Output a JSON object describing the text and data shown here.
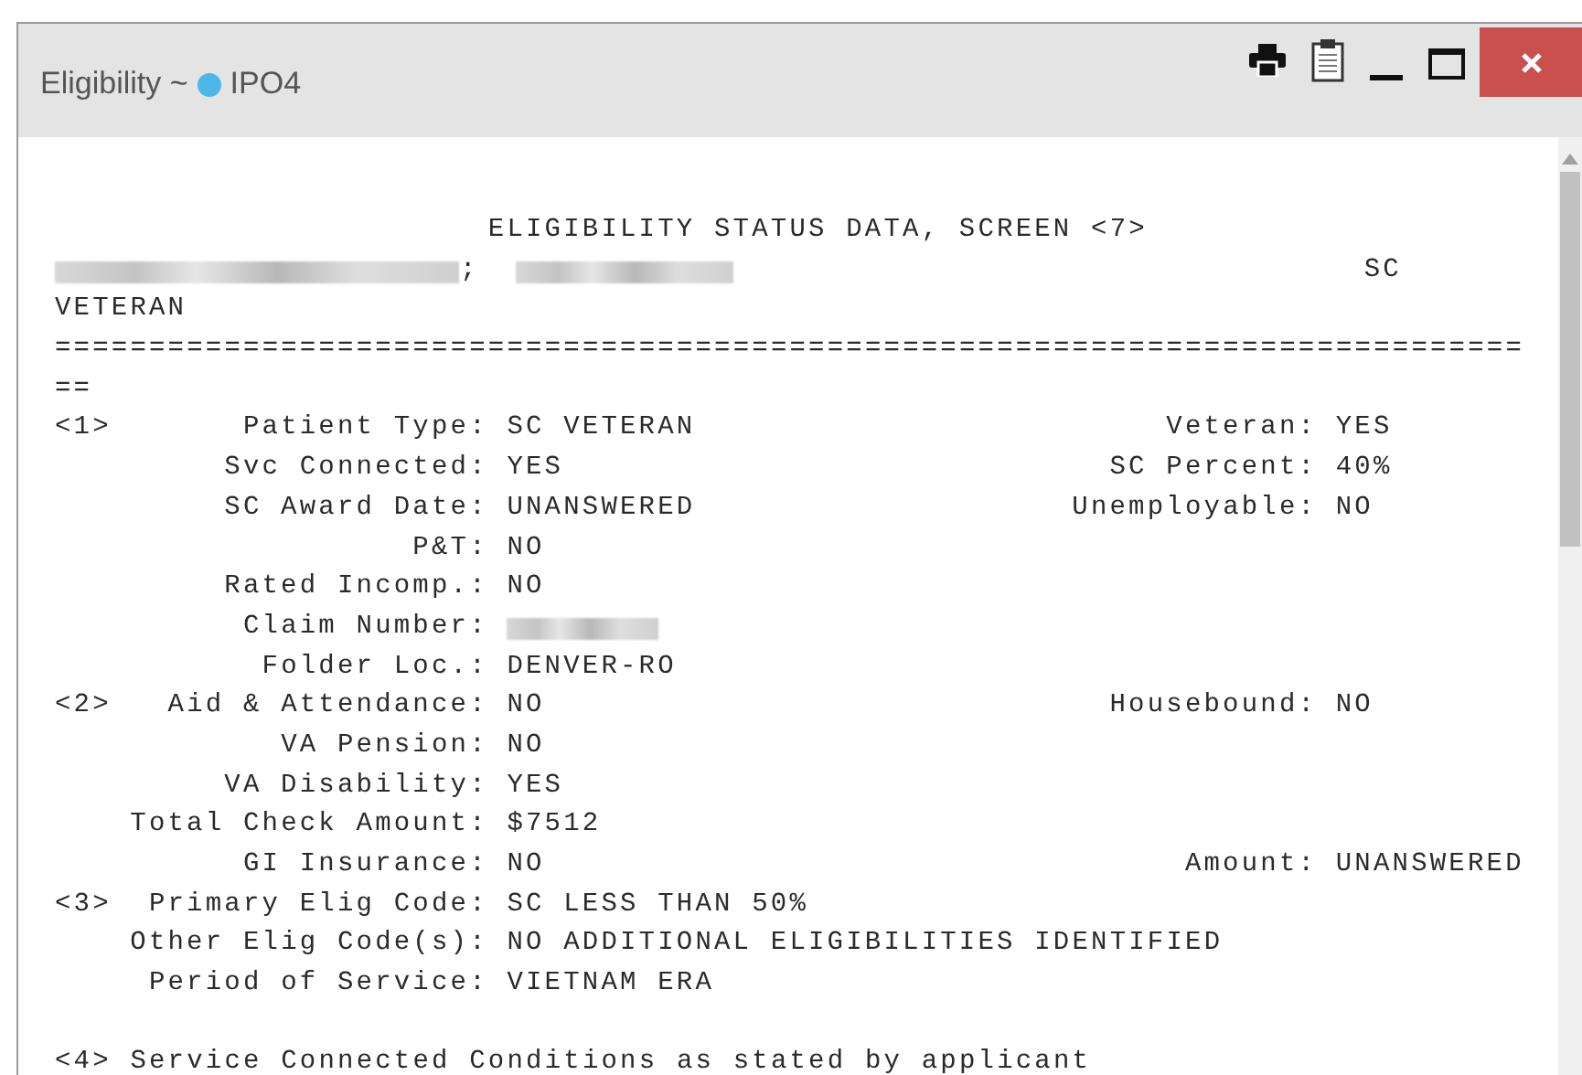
{
  "window": {
    "title": "Eligibility ~",
    "patient": "IPO4"
  },
  "report": {
    "title": "ELIGIBILITY STATUS DATA, SCREEN <7>",
    "header": {
      "separator": ";",
      "trailing": "SC"
    },
    "header_wrap": "VETERAN",
    "rule": "==============================================================================",
    "rule_wrap": "==",
    "rows": [
      {
        "kind": "field",
        "marker": "<1>",
        "label": "Patient Type:",
        "value": "SC VETERAN",
        "right_label": "Veteran:",
        "right_value": "YES"
      },
      {
        "kind": "field",
        "label": "Svc Connected:",
        "value": "YES",
        "right_label": "SC Percent:",
        "right_value": "40%"
      },
      {
        "kind": "field",
        "label": "SC Award Date:",
        "value": "UNANSWERED",
        "right_label": "Unemployable:",
        "right_value": "NO"
      },
      {
        "kind": "field",
        "label": "P&T:",
        "value": "NO"
      },
      {
        "kind": "field",
        "label": "Rated Incomp.:",
        "value": "NO"
      },
      {
        "kind": "redacted",
        "label": "Claim Number:"
      },
      {
        "kind": "field",
        "label": "Folder Loc.:",
        "value": "DENVER-RO"
      },
      {
        "kind": "field",
        "marker": "<2>",
        "label": "Aid & Attendance:",
        "value": "NO",
        "right_label": "Housebound:",
        "right_value": "NO"
      },
      {
        "kind": "field",
        "label": "VA Pension:",
        "value": "NO"
      },
      {
        "kind": "field",
        "label": "VA Disability:",
        "value": "YES"
      },
      {
        "kind": "field",
        "label": "Total Check Amount:",
        "value": "$7512"
      },
      {
        "kind": "field",
        "label": "GI Insurance:",
        "value": "NO",
        "right_label": "Amount:",
        "right_value": "UNANSWERED"
      },
      {
        "kind": "field",
        "marker": "<3>",
        "label": "Primary Elig Code:",
        "value": "SC LESS THAN 50%"
      },
      {
        "kind": "field",
        "label": "Other Elig Code(s):",
        "value": "NO ADDITIONAL ELIGIBILITIES IDENTIFIED"
      },
      {
        "kind": "field",
        "label": "Period of Service:",
        "value": "VIETNAM ERA"
      },
      {
        "kind": "blank"
      }
    ],
    "footer": "<4> Service Connected Conditions as stated by applicant"
  }
}
